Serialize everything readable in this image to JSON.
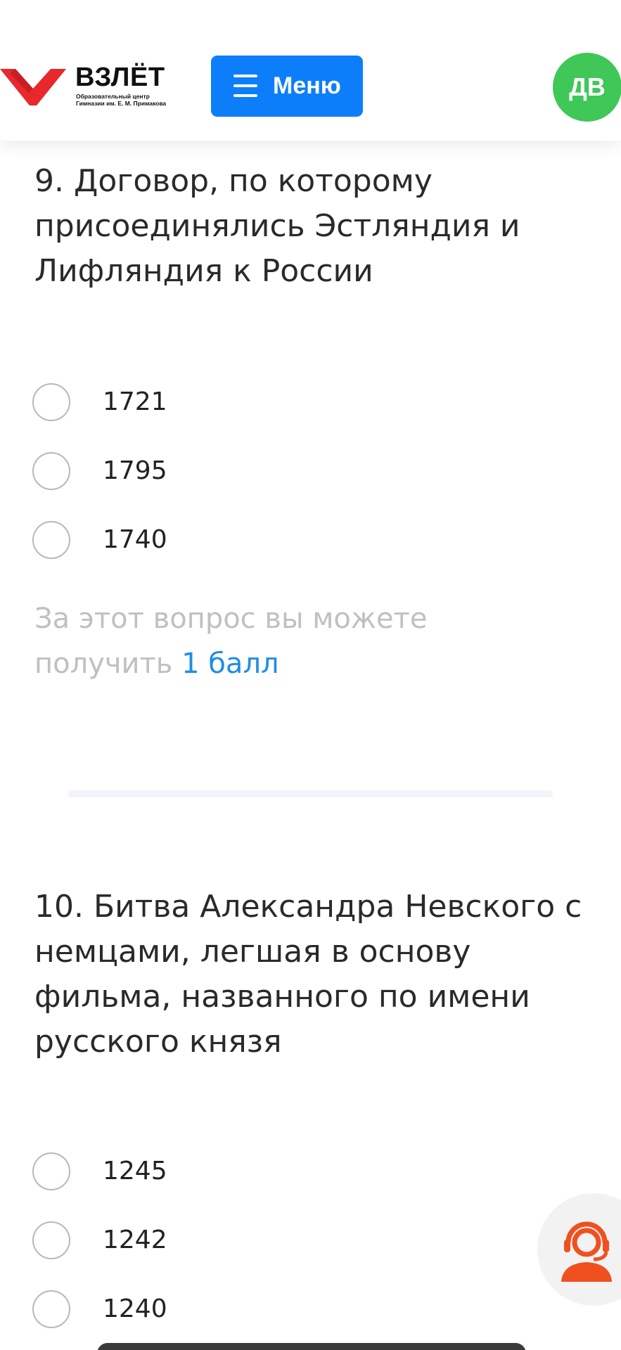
{
  "header": {
    "logo": {
      "title": "ВЗЛЁТ",
      "subtitle_line1": "Образовательный центр",
      "subtitle_line2": "Гимназии им. Е. М. Примакова",
      "mark_color": "#e8282c"
    },
    "menu_label": "Меню",
    "menu_color": "#0d7efa",
    "avatar_initials": "ДВ",
    "avatar_color": "#3fc758"
  },
  "questions": [
    {
      "title": "9. Договор, по которому присоединялись Эстляндия и Лифляндия к России",
      "options": [
        "1721",
        "1795",
        "1740"
      ],
      "points_text": "За этот вопрос вы можете получить",
      "points_value": "1 балл"
    },
    {
      "title": "10. Битва Александра Невского с немцами, легшая в основу фильма, названного по имени русского князя",
      "options": [
        "1245",
        "1242",
        "1240"
      ]
    }
  ],
  "support": {
    "icon": "support-agent-icon",
    "color": "#f0501e"
  }
}
